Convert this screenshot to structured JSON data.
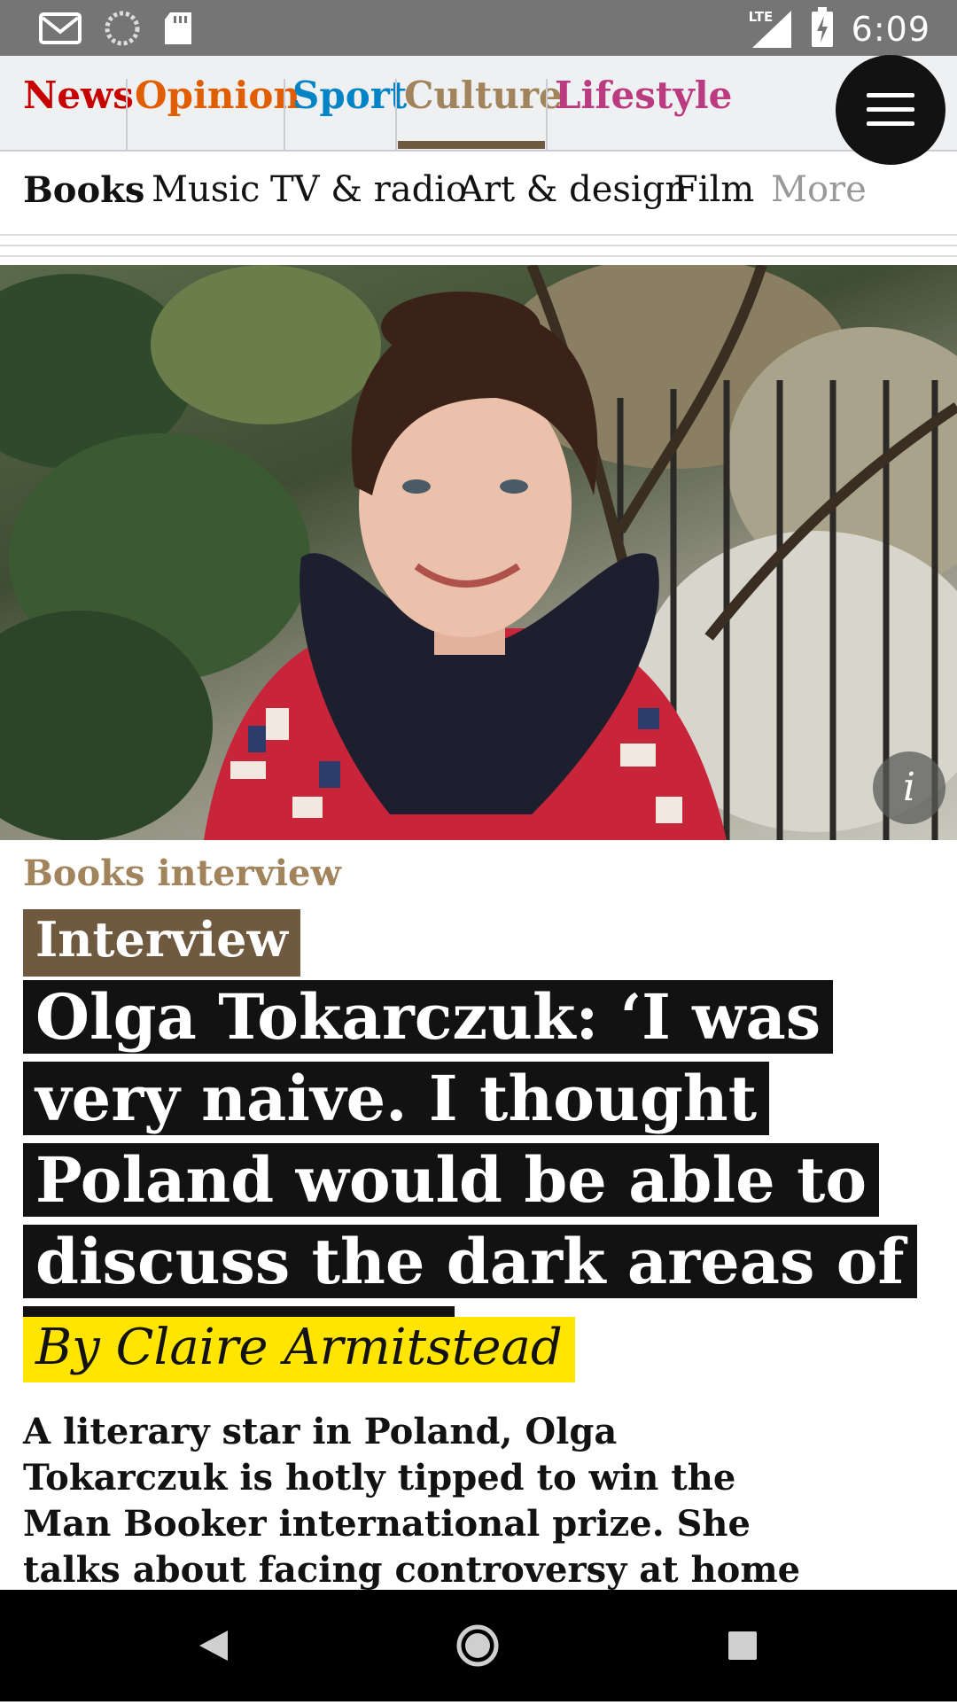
{
  "status_bar": {
    "time": "6:09",
    "network": "LTE",
    "icons": [
      "gmail-icon",
      "sync-icon",
      "sd-card-icon",
      "signal-icon",
      "battery-charging-icon"
    ]
  },
  "pillars": [
    {
      "label": "News",
      "color": "#c70000"
    },
    {
      "label": "Opinion",
      "color": "#e05e00"
    },
    {
      "label": "Sport",
      "color": "#0084c6"
    },
    {
      "label": "Culture",
      "color": "#a1845c",
      "active": true
    },
    {
      "label": "Lifestyle",
      "color": "#bb3b80"
    }
  ],
  "subnav": [
    {
      "label": "Books",
      "active": true
    },
    {
      "label": "Music"
    },
    {
      "label": "TV & radio"
    },
    {
      "label": "Art & design"
    },
    {
      "label": "Film"
    },
    {
      "label": "More",
      "muted": true
    }
  ],
  "article": {
    "kicker": "Books interview",
    "series": "Interview",
    "headline": "Olga Tokarczuk: ‘I was very naive. I thought Poland would be able to discuss the dark areas of our history’",
    "byline": "By Claire Armitstead",
    "standfirst": "A literary star in Poland, Olga Tokarczuk is hotly tipped to win the Man Booker international prize. She talks about facing controversy at home and the armed"
  },
  "colors": {
    "culture_accent": "#a1845c",
    "culture_dark": "#6f5a40",
    "byline_highlight": "#ffe500",
    "headline_bg": "#121212"
  }
}
